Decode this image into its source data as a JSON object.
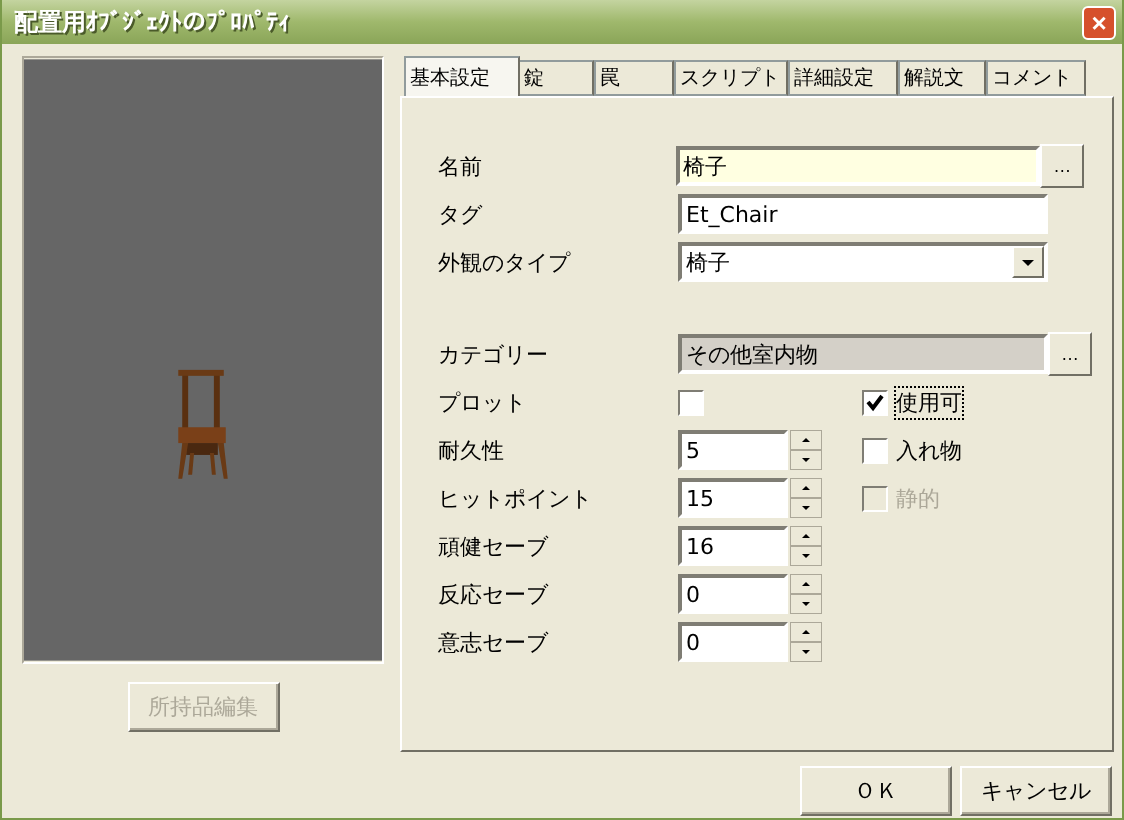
{
  "window": {
    "title": "配置用ｵﾌﾞｼﾞｪｸﾄのﾌﾟﾛﾊﾟﾃｨ",
    "close": "×"
  },
  "inventory_button": {
    "label": "所持品編集",
    "disabled": true
  },
  "tabs": [
    {
      "label": "基本設定",
      "selected": true
    },
    {
      "label": "錠",
      "selected": false
    },
    {
      "label": "罠",
      "selected": false
    },
    {
      "label": "スクリプト",
      "selected": false
    },
    {
      "label": "詳細設定",
      "selected": false
    },
    {
      "label": "解説文",
      "selected": false
    },
    {
      "label": "コメント",
      "selected": false
    }
  ],
  "top_fields": [
    {
      "label": "名前",
      "kind": "text",
      "value": "椅子",
      "highlight": true,
      "browse": "…"
    },
    {
      "label": "タグ",
      "kind": "text",
      "value": "Et_Chair",
      "highlight": false
    },
    {
      "label": "外観のタイプ",
      "kind": "dropdown",
      "value": "椅子"
    }
  ],
  "category": {
    "label": "カテゴリー",
    "value": "その他室内物",
    "browse": "…"
  },
  "fields": [
    {
      "label": "プロット",
      "kind": "checkbox",
      "checked": false
    },
    {
      "label": "耐久性",
      "kind": "spin",
      "value": "5"
    },
    {
      "label": "ヒットポイント",
      "kind": "spin",
      "value": "15"
    },
    {
      "label": "頑健セーブ",
      "kind": "spin",
      "value": "16"
    },
    {
      "label": "反応セーブ",
      "kind": "spin",
      "value": "0"
    },
    {
      "label": "意志セーブ",
      "kind": "spin",
      "value": "0"
    }
  ],
  "options": [
    {
      "label": "使用可",
      "checked": true,
      "disabled": false,
      "focused": true
    },
    {
      "label": "入れ物",
      "checked": false,
      "disabled": false,
      "focused": false
    },
    {
      "label": "静的",
      "checked": false,
      "disabled": true,
      "focused": false
    }
  ],
  "buttons": [
    {
      "label": "ＯＫ"
    },
    {
      "label": "キャンセル"
    }
  ]
}
